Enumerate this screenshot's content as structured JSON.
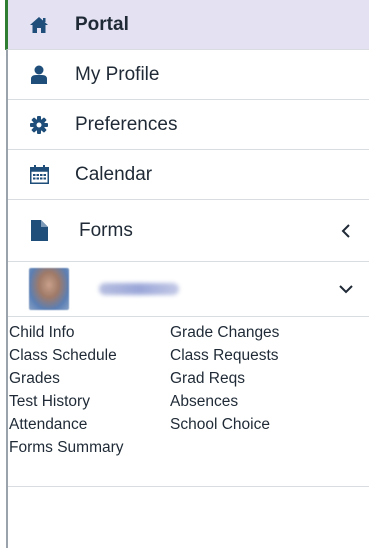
{
  "nav": {
    "items": [
      {
        "label": "Portal",
        "icon": "home-icon",
        "active": true
      },
      {
        "label": "My Profile",
        "icon": "user-icon"
      },
      {
        "label": "Preferences",
        "icon": "gear-icon"
      },
      {
        "label": "Calendar",
        "icon": "calendar-icon"
      },
      {
        "label": "Forms",
        "icon": "file-icon"
      }
    ]
  },
  "student": {
    "links": [
      [
        "Child Info",
        "Grade Changes"
      ],
      [
        "Class Schedule",
        "Class Requests"
      ],
      [
        "Grades",
        "Grad Reqs"
      ],
      [
        "Test History",
        "Absences"
      ],
      [
        "Attendance",
        "School Choice"
      ],
      [
        "Forms Summary",
        ""
      ]
    ]
  },
  "colors": {
    "icon": "#1e4e79",
    "active_bg": "#e3e1f2",
    "active_border": "#2e7d32",
    "text": "#1f2a36",
    "divider": "#d9dde1"
  }
}
